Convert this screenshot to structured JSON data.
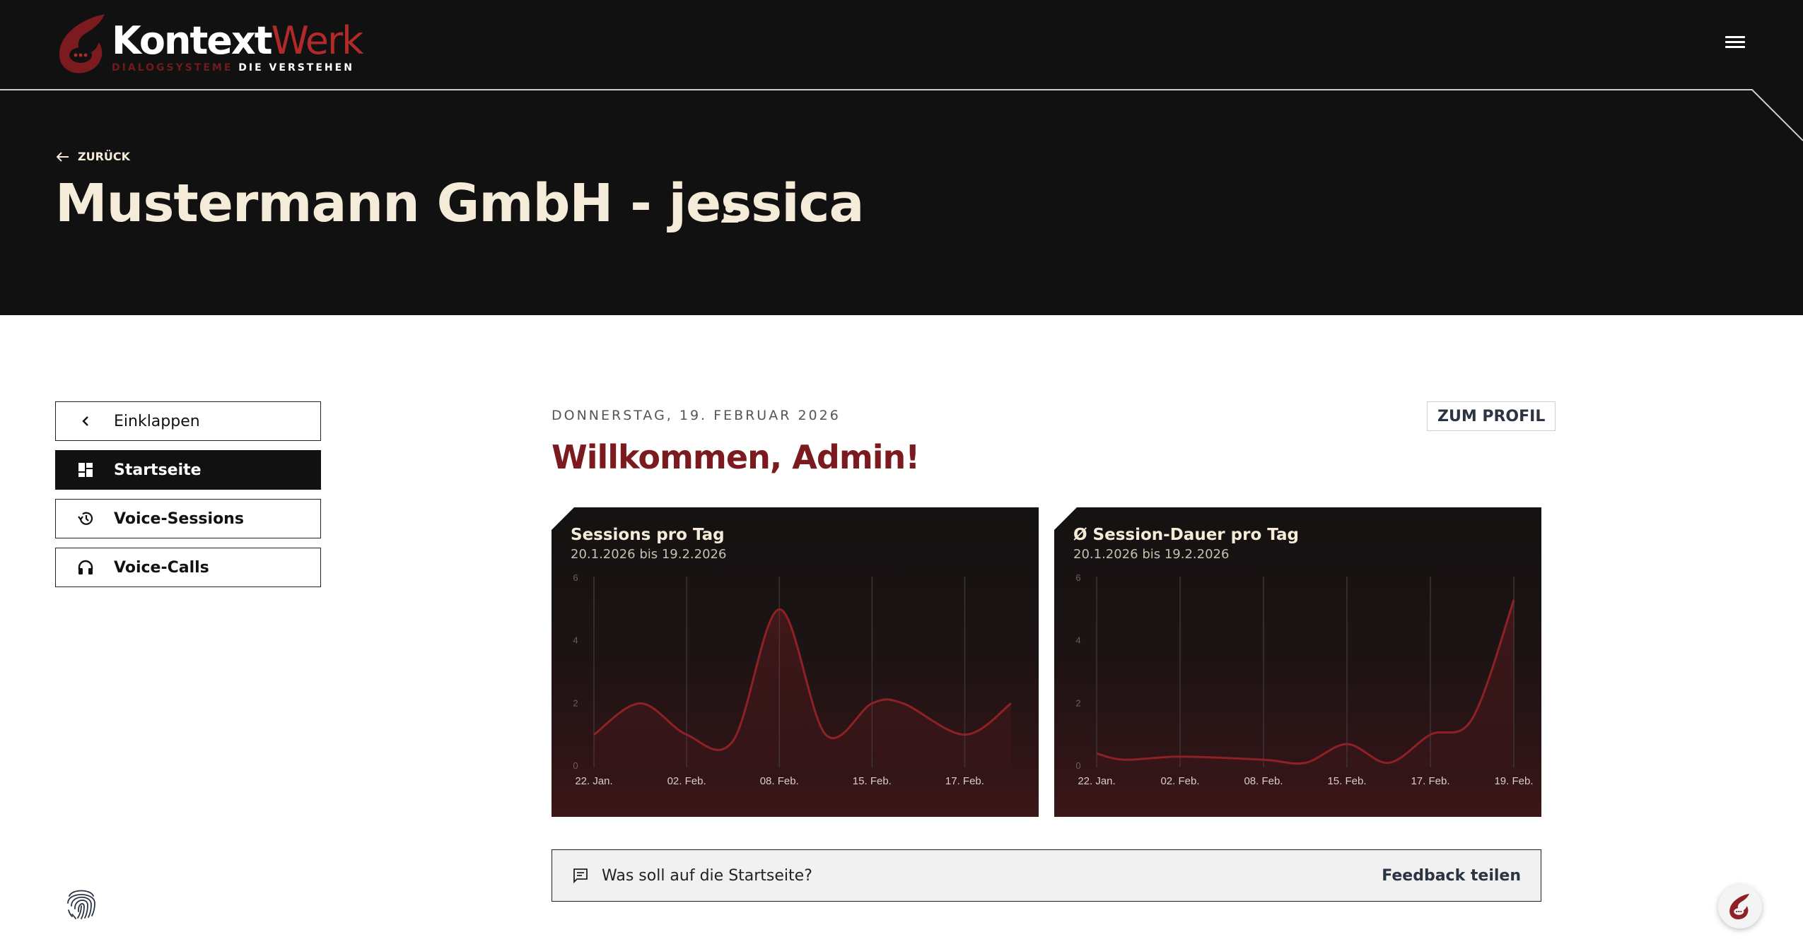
{
  "brand": {
    "name_part1": "Kontext",
    "name_part2": "Werk",
    "tagline_part1": "DIALOGSYSTEME",
    "tagline_part2": "DIE VERSTEHEN",
    "accent_color": "#b12a2a"
  },
  "header": {
    "back_label": "ZURÜCK",
    "title": "Mustermann GmbH - jessica",
    "menu_icon": "hamburger-menu-icon",
    "user_status_icon": "user-question-icon"
  },
  "sidebar": {
    "items": [
      {
        "label": "Einklappen",
        "icon": "chevron-left-icon",
        "active": false
      },
      {
        "label": "Startseite",
        "icon": "dashboard-icon",
        "active": true
      },
      {
        "label": "Voice-Sessions",
        "icon": "history-icon",
        "active": false
      },
      {
        "label": "Voice-Calls",
        "icon": "headset-icon",
        "active": false
      }
    ]
  },
  "main": {
    "date": "DONNERSTAG, 19. FEBRUAR 2026",
    "profile_button": "ZUM PROFIL",
    "welcome": "Willkommen, Admin!",
    "feedback": {
      "question": "Was soll auf die Startseite?",
      "button": "Feedback teilen"
    }
  },
  "chart_data": [
    {
      "type": "area",
      "title": "Sessions pro Tag",
      "subtitle": "20.1.2026 bis 19.2.2026",
      "xlabel": "",
      "ylabel": "",
      "ylim": [
        0,
        6
      ],
      "yticks": [
        "0",
        "2",
        "4",
        "6"
      ],
      "xticks": [
        "22. Jan.",
        "02. Feb.",
        "08. Feb.",
        "15. Feb.",
        "17. Feb."
      ],
      "x_range": [
        0,
        27
      ],
      "xtick_pos": [
        0,
        6,
        12,
        18,
        24
      ],
      "x": [
        0,
        3,
        6,
        9,
        12,
        15,
        18,
        20,
        24,
        27
      ],
      "values": [
        1.0,
        2.0,
        1.0,
        0.8,
        5.0,
        1.0,
        2.0,
        2.0,
        1.0,
        2.0
      ],
      "grid": true,
      "line_color": "#8e2125"
    },
    {
      "type": "area",
      "title": "Ø Session-Dauer pro Tag",
      "subtitle": "20.1.2026 bis 19.2.2026",
      "xlabel": "",
      "ylabel": "",
      "ylim": [
        0,
        6
      ],
      "yticks": [
        "0",
        "2",
        "4",
        "6"
      ],
      "xticks": [
        "22. Jan.",
        "02. Feb.",
        "08. Feb.",
        "15. Feb.",
        "17. Feb.",
        "19. Feb."
      ],
      "x_range": [
        0,
        30
      ],
      "xtick_pos": [
        0,
        6,
        12,
        18,
        24,
        30
      ],
      "x": [
        0,
        2,
        6,
        12,
        15,
        18,
        21,
        24,
        27,
        30
      ],
      "values": [
        0.4,
        0.2,
        0.3,
        0.2,
        0.1,
        0.7,
        0.1,
        1.0,
        1.5,
        5.3
      ],
      "grid": true,
      "line_color": "#8e2125"
    }
  ]
}
